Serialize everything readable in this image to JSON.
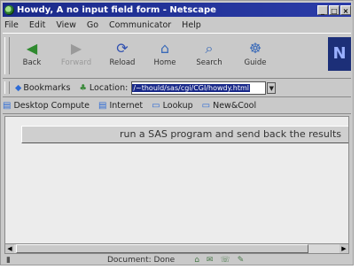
{
  "window": {
    "title": "Howdy, A no input field form - Netscape",
    "controls": [
      "_",
      "□",
      "×"
    ]
  },
  "menu": [
    "File",
    "Edit",
    "View",
    "Go",
    "Communicator",
    "Help"
  ],
  "toolbar": {
    "buttons": [
      {
        "label": "Back",
        "icon": "back-arrow-icon",
        "glyph": "◀"
      },
      {
        "label": "Forward",
        "icon": "forward-arrow-icon",
        "glyph": "▶"
      },
      {
        "label": "Reload",
        "icon": "reload-icon",
        "glyph": "⟳"
      },
      {
        "label": "Home",
        "icon": "home-icon",
        "glyph": "⌂"
      },
      {
        "label": "Search",
        "icon": "search-icon",
        "glyph": "⌕"
      },
      {
        "label": "Guide",
        "icon": "guide-icon",
        "glyph": "☸"
      }
    ],
    "logo": "N"
  },
  "location": {
    "bookmarks_label": "Bookmarks",
    "location_label": "Location:",
    "url": "/~thould/sas/cgi/CGI/howdy.html"
  },
  "personal_toolbar": [
    "Desktop Compute",
    "Internet",
    "Lookup",
    "New&Cool"
  ],
  "content": {
    "submit_label": "run a SAS program and send back the results"
  },
  "status": {
    "text": "Document: Done"
  },
  "colors": {
    "titlebar": "#1a2a8a",
    "chrome": "#c9c9c9"
  }
}
